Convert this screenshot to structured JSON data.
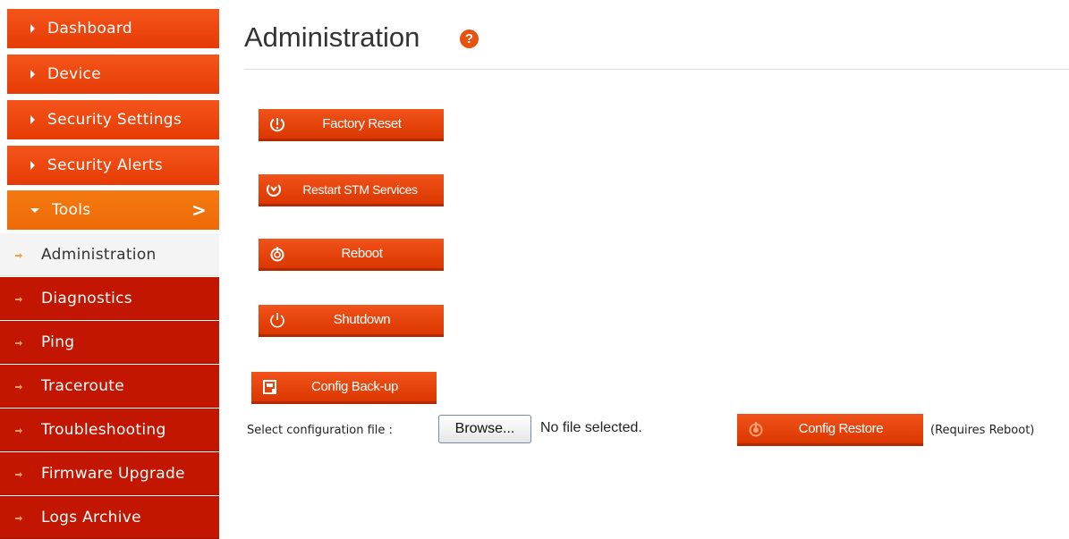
{
  "sidebar": {
    "top_items": [
      {
        "label": "Dashboard"
      },
      {
        "label": "Device"
      },
      {
        "label": "Security Settings"
      },
      {
        "label": "Security Alerts"
      },
      {
        "label": "Tools",
        "chevron": ">"
      }
    ],
    "sub_items": [
      {
        "label": "Administration"
      },
      {
        "label": "Diagnostics"
      },
      {
        "label": "Ping"
      },
      {
        "label": "Traceroute"
      },
      {
        "label": "Troubleshooting"
      },
      {
        "label": "Firmware Upgrade"
      },
      {
        "label": "Logs Archive"
      }
    ]
  },
  "main": {
    "title": "Administration",
    "help_icon_glyph": "?",
    "buttons": {
      "factory_reset": "Factory Reset",
      "restart_stm": "Restart STM Services",
      "reboot": "Reboot",
      "shutdown": "Shutdown",
      "config_backup": "Config Back-up",
      "config_restore": "Config Restore"
    },
    "config_file": {
      "label": "Select configuration file :",
      "browse_label": "Browse...",
      "status": "No file selected."
    },
    "restore_note": "(Requires Reboot)"
  },
  "colors": {
    "accent": "#e63b06",
    "tools_active": "#f06e0a",
    "submenu_bg": "#c31600"
  },
  "icons": [
    "power-reset-icon",
    "restart-icon",
    "reboot-icon",
    "power-icon",
    "backup-icon",
    "restore-icon",
    "help-icon"
  ]
}
